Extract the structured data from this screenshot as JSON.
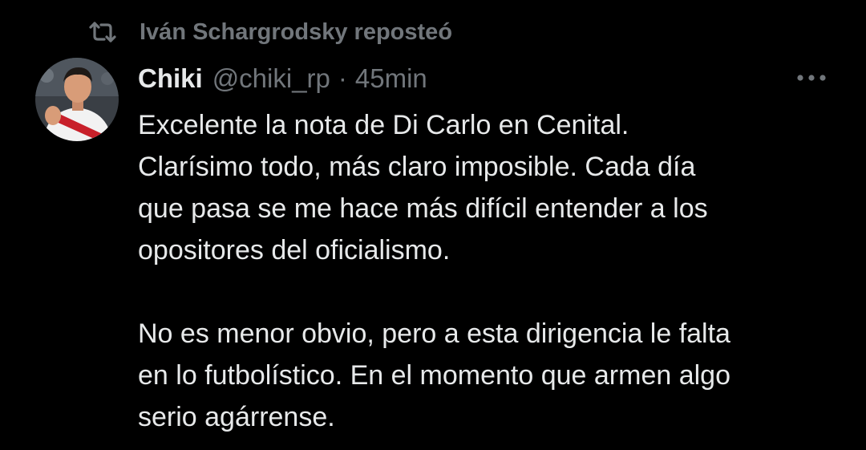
{
  "repost": {
    "icon": "repost-icon",
    "text": "Iván Schargrodsky reposteó"
  },
  "tweet": {
    "avatar_icon": "avatar-photo",
    "display_name": "Chiki",
    "handle": "@chiki_rp",
    "separator": "·",
    "time": "45min",
    "more_icon": "more-dots-icon",
    "paragraphs": [
      {
        "lines": [
          "Excelente la nota de Di Carlo en Cenital.",
          "Clarísimo todo, más claro imposible. Cada día",
          "que pasa se me hace más difícil entender a los",
          "opositores del oficialismo."
        ]
      },
      {
        "lines": [
          "No es menor obvio, pero a esta dirigencia le falta",
          "en lo futbolístico. En el momento que armen algo",
          "serio agárrense."
        ]
      }
    ]
  },
  "colors": {
    "background": "#000000",
    "text_primary": "#e7e9ea",
    "text_secondary": "#71767b",
    "jersey_red": "#c8202a",
    "jersey_white": "#f2f2f2"
  }
}
